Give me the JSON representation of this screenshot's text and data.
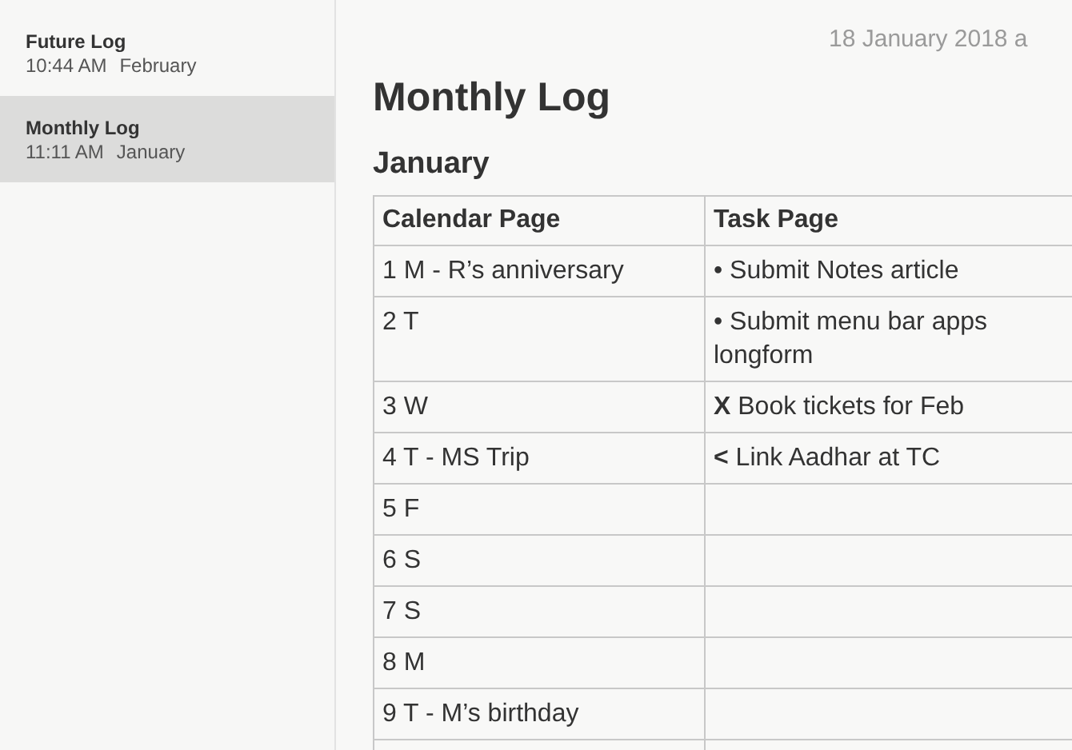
{
  "sidebar": {
    "notes": [
      {
        "title": "Future Log",
        "time": "10:44 AM",
        "preview": "February",
        "selected": false
      },
      {
        "title": "Monthly Log",
        "time": "11:11 AM",
        "preview": "January",
        "selected": true
      }
    ]
  },
  "note": {
    "date": "18 January 2018 a",
    "title": "Monthly Log",
    "heading": "January",
    "table": {
      "columns": [
        "Calendar Page",
        "Task Page"
      ],
      "rows": [
        [
          "1 M - R’s anniversary",
          "• Submit Notes article"
        ],
        [
          "2 T",
          "• Submit menu bar apps longform"
        ],
        [
          "3 W",
          "**X** Book tickets for Feb"
        ],
        [
          "4 T - MS Trip",
          "**<** Link Aadhar at TC"
        ],
        [
          "5 F",
          ""
        ],
        [
          "6 S",
          ""
        ],
        [
          "7 S",
          ""
        ],
        [
          "8 M",
          ""
        ],
        [
          "9 T - M’s birthday",
          ""
        ]
      ]
    }
  }
}
